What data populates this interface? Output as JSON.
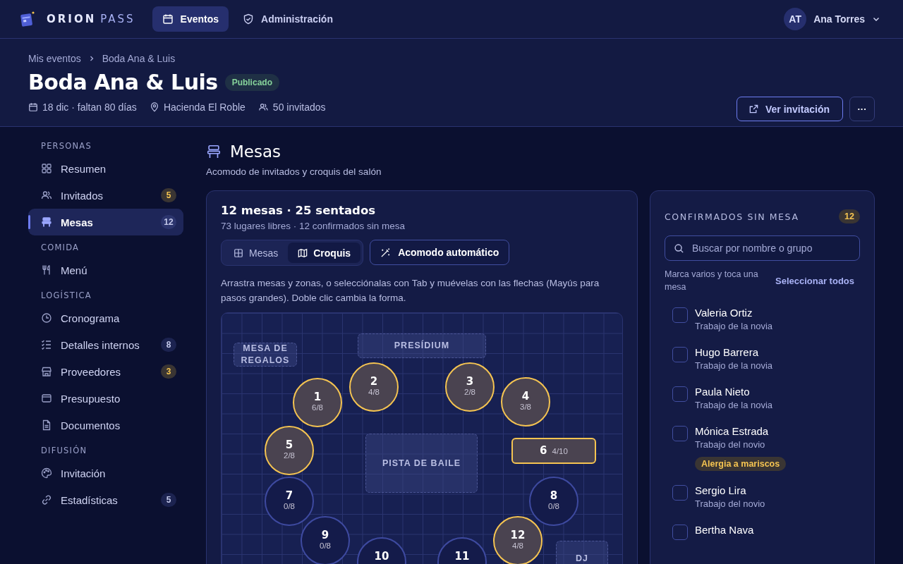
{
  "brand": {
    "primary": "ORION",
    "secondary": "PASS"
  },
  "nav": [
    {
      "label": "Eventos",
      "selected": true
    },
    {
      "label": "Administración",
      "selected": false
    }
  ],
  "user": {
    "initials": "AT",
    "name": "Ana Torres"
  },
  "breadcrumb": [
    "Mis eventos",
    "Boda Ana & Luis"
  ],
  "event": {
    "title": "Boda Ana & Luis",
    "status": "Publicado",
    "date": "18 dic · faltan 80 días",
    "venue": "Hacienda El Roble",
    "guests": "50 invitados"
  },
  "header_actions": {
    "view": "Ver invitación",
    "more": "···"
  },
  "sidebar": [
    {
      "heading": "PERSONAS",
      "items": [
        {
          "label": "Resumen",
          "selected": false
        },
        {
          "label": "Invitados",
          "badge": "5",
          "badge_alert": true,
          "selected": false
        },
        {
          "label": "Mesas",
          "badge": "12",
          "badge_alert": false,
          "selected": true
        }
      ]
    },
    {
      "heading": "COMIDA",
      "items": [
        {
          "label": "Menú",
          "selected": false
        }
      ]
    },
    {
      "heading": "LOGÍSTICA",
      "items": [
        {
          "label": "Cronograma",
          "selected": false
        },
        {
          "label": "Detalles internos",
          "badge": "8",
          "badge_alert": false,
          "selected": false
        },
        {
          "label": "Proveedores",
          "badge": "3",
          "badge_alert": true,
          "selected": false
        },
        {
          "label": "Presupuesto",
          "selected": false
        },
        {
          "label": "Documentos",
          "selected": false
        }
      ]
    },
    {
      "heading": "DIFUSIÓN",
      "items": [
        {
          "label": "Invitación",
          "selected": false
        },
        {
          "label": "Estadísticas",
          "badge": "5",
          "badge_alert": false,
          "selected": false
        }
      ]
    }
  ],
  "page": {
    "title": "Mesas",
    "subtitle": "Acomodo de invitados y croquis del salón"
  },
  "summary": {
    "title": "12 mesas · 25 sentados",
    "subtitle": "73 lugares libres · 12 confirmados sin mesa"
  },
  "view_tabs": [
    {
      "label": "Mesas",
      "selected": false
    },
    {
      "label": "Croquis",
      "selected": true
    }
  ],
  "auto_button": "Acomodo automático",
  "instructions": "Arrastra mesas y zonas, o selecciónalas con Tab y muévelas con las flechas (Mayús para pasos grandes). Doble clic cambia la forma.",
  "zones": [
    {
      "label": "MESA DE REGALOS"
    },
    {
      "label": "PRESÍDIUM"
    },
    {
      "label": "PISTA DE BAILE"
    },
    {
      "label": "DJ"
    }
  ],
  "tables": [
    {
      "kind": "round",
      "number": "1",
      "seats": "6/8",
      "filled": true
    },
    {
      "kind": "round",
      "number": "2",
      "seats": "4/8",
      "filled": true
    },
    {
      "kind": "round",
      "number": "3",
      "seats": "2/8",
      "filled": true
    },
    {
      "kind": "round",
      "number": "4",
      "seats": "3/8",
      "filled": true
    },
    {
      "kind": "round",
      "number": "5",
      "seats": "2/8",
      "filled": true
    },
    {
      "kind": "rect",
      "number": "6",
      "seats": "4/10",
      "filled": true
    },
    {
      "kind": "round",
      "number": "7",
      "seats": "0/8",
      "filled": false
    },
    {
      "kind": "round",
      "number": "8",
      "seats": "0/8",
      "filled": false
    },
    {
      "kind": "round",
      "number": "9",
      "seats": "0/8",
      "filled": false
    },
    {
      "kind": "round",
      "number": "10",
      "filled": false
    },
    {
      "kind": "round",
      "number": "11",
      "filled": false
    },
    {
      "kind": "round",
      "number": "12",
      "seats": "4/8",
      "filled": true
    }
  ],
  "unseated": {
    "title": "CONFIRMADOS SIN MESA",
    "count": "12",
    "search_placeholder": "Buscar por nombre o grupo",
    "hint": "Marca varios y toca una mesa",
    "select_all": "Seleccionar todos",
    "guests": [
      {
        "name": "Valeria Ortiz",
        "group": "Trabajo de la novia",
        "checked": false
      },
      {
        "name": "Hugo Barrera",
        "group": "Trabajo de la novia",
        "checked": false
      },
      {
        "name": "Paula Nieto",
        "group": "Trabajo de la novia",
        "checked": false
      },
      {
        "name": "Mónica Estrada",
        "group": "Trabajo del novio",
        "tag": "Alergia a mariscos",
        "checked": false
      },
      {
        "name": "Sergio Lira",
        "group": "Trabajo del novio",
        "checked": false
      },
      {
        "name": "Bertha Nava",
        "checked": false
      }
    ]
  }
}
